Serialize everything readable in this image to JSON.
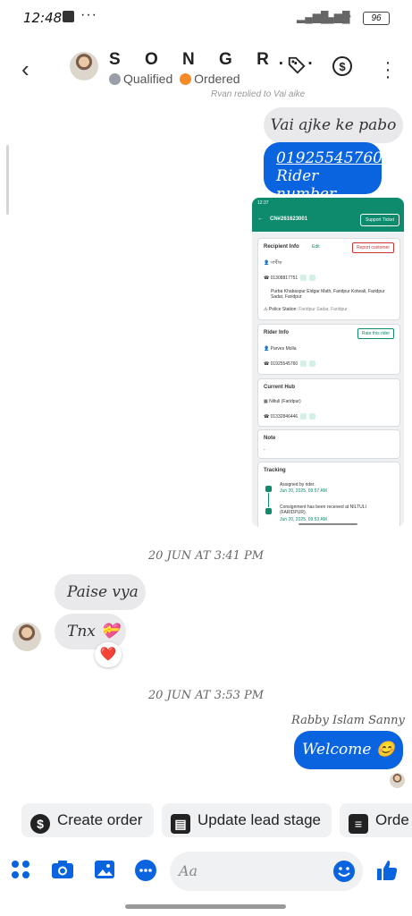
{
  "status_bar": {
    "time": "12:48",
    "dots": "···",
    "battery": "96"
  },
  "header": {
    "name": "S O N G R...",
    "status_1": "Qualified",
    "status_1_color": "#9a9ea6",
    "status_2": "Ordered",
    "status_2_color": "#f58a2a",
    "icons": [
      "back-icon",
      "tag-icon",
      "dollar-icon",
      "more-icon"
    ]
  },
  "messages": {
    "partial_top": "Ryan replied to Vai ajke",
    "out_1": "Vai ajke ke pabo",
    "out_2_phone": "01925545760",
    "out_2_text": "Rider number",
    "time_1": "20 JUN AT 3:41 PM",
    "in_1": "Paise vya",
    "in_2": "Tnx 💝",
    "reaction": "❤️",
    "time_2": "20 JUN AT 3:53 PM",
    "sender": "Rabby Islam Sanny",
    "out_3": "Welcome 😊"
  },
  "screenshot": {
    "time": "12:37",
    "title": "CN#261623001",
    "support": "Support Ticket",
    "recipient_title": "Recipient Info",
    "edit": "Edit",
    "report": "Report customer",
    "recipient_name": "সাথীক",
    "recipient_phone": "01308817751",
    "address": "Purba Khabaspur Eidgar Math, Faridpur Kotwali, Faridpur Sadar, Faridpur",
    "police_label": "Police Station:",
    "police": "Faridpur Sadar, Faridpur",
    "rider_title": "Rider Info",
    "rate": "Rate this rider",
    "rider_name": "Parves Molla",
    "rider_phone": "01925545760",
    "hub_title": "Current Hub",
    "hub_name": "Niltuli (Faridpur)",
    "hub_phone": "01332846446",
    "note_title": "Note",
    "note_value": "-",
    "tracking_title": "Tracking",
    "track_1": "Assigned by rider.",
    "track_1_date": "Jun 20, 2025, 09:57 AM",
    "track_2": "Consignment has been received at NILTULI (FARIDPUR).",
    "track_2_date": "Jun 20, 2025, 09:53 AM"
  },
  "actions": [
    {
      "label": "Create order",
      "icon": "dollar-icon"
    },
    {
      "label": "Update lead stage",
      "icon": "contact-card-icon"
    },
    {
      "label": "Orde",
      "icon": "list-icon"
    }
  ],
  "composer": {
    "placeholder": "Aa"
  }
}
